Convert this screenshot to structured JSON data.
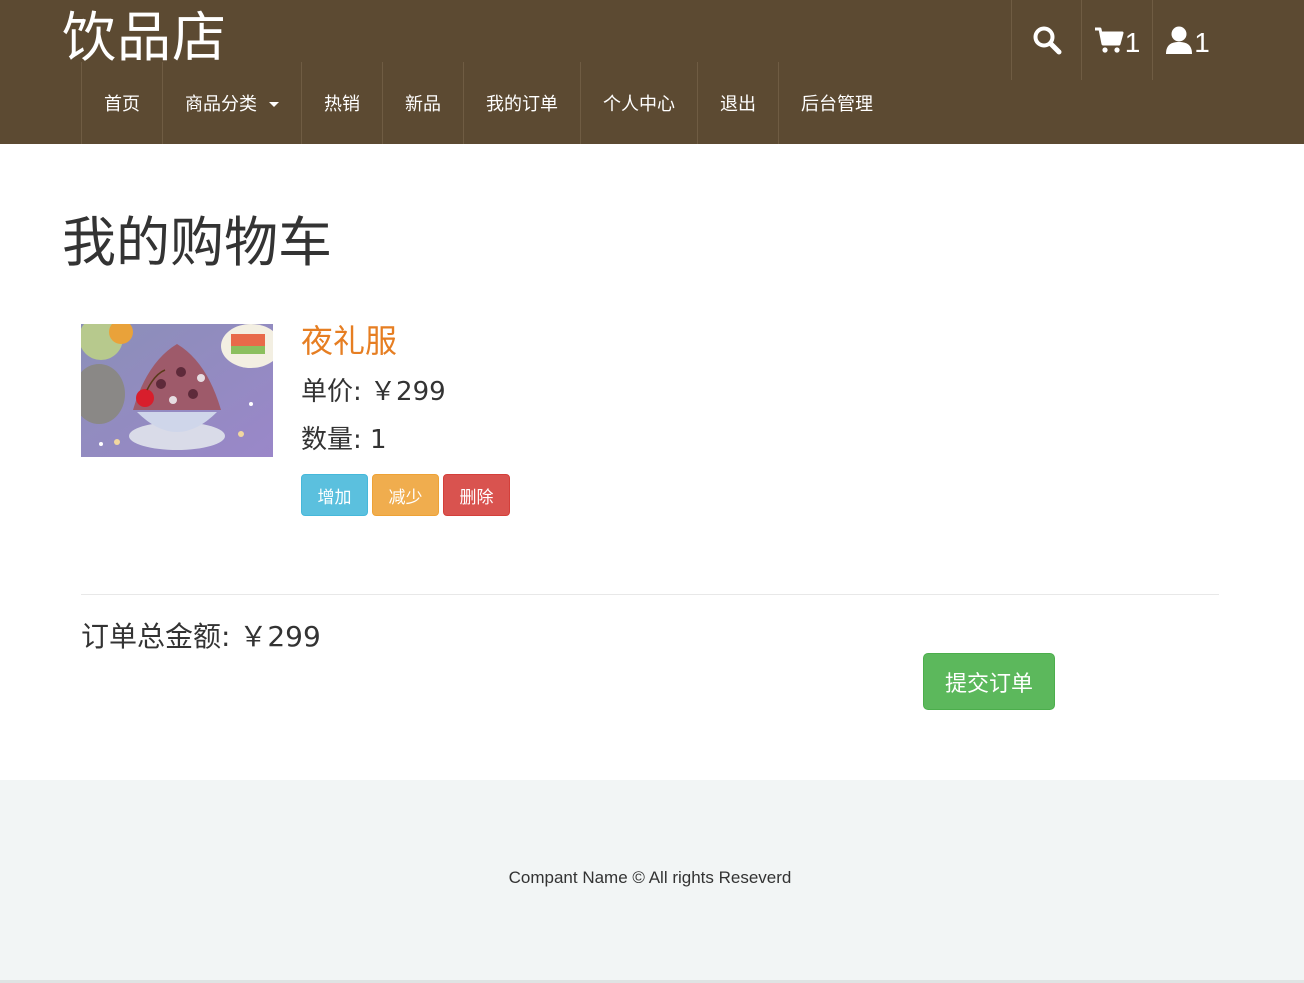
{
  "header": {
    "logo": "饮品店",
    "nav": [
      {
        "label": "首页"
      },
      {
        "label": "商品分类"
      },
      {
        "label": "热销"
      },
      {
        "label": "新品"
      },
      {
        "label": "我的订单"
      },
      {
        "label": "个人中心"
      },
      {
        "label": "退出"
      },
      {
        "label": "后台管理"
      }
    ],
    "tools": {
      "search_icon": "search-icon",
      "cart_icon": "cart-icon",
      "cart_count": "1",
      "user_icon": "user-icon",
      "user_count": "1"
    },
    "colors": {
      "background": "#5c4a32",
      "text": "#ffffff"
    }
  },
  "main": {
    "title": "我的购物车",
    "cart_items": [
      {
        "name": "夜礼服",
        "price": "单价: ￥299",
        "quantity": "数量: 1",
        "buttons": {
          "increase": "增加",
          "decrease": "减少",
          "delete": "删除"
        }
      }
    ],
    "total": "订单总金额: ￥299",
    "submit_label": "提交订单",
    "colors": {
      "item_name": "#e67e22",
      "increase": "#5bc0de",
      "decrease": "#f0ad4e",
      "delete": "#d9534f",
      "submit": "#5cb85c"
    }
  },
  "footer": {
    "text": "Compant Name © All rights Reseverd"
  }
}
